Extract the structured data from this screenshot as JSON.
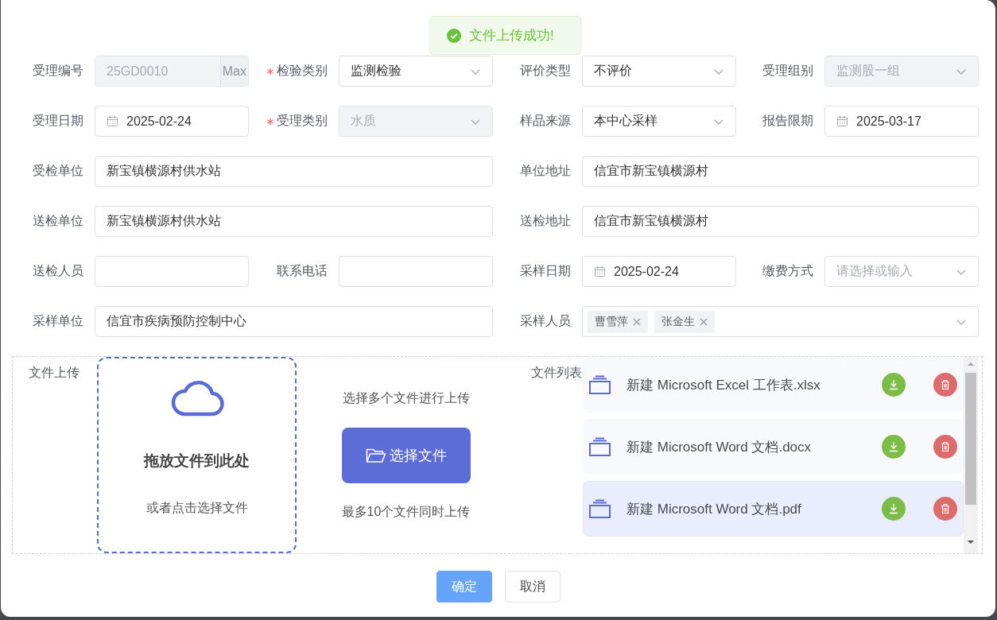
{
  "toast": {
    "message": "文件上传成功!"
  },
  "form_rows": [
    [
      {
        "label": "受理编号",
        "required": false,
        "kind": "addon",
        "value": "25GD0010",
        "addon": "Max",
        "disabled": true,
        "wide": false
      },
      {
        "label": "检验类别",
        "required": true,
        "kind": "select",
        "value": "监测检验",
        "disabled": false,
        "wide": false
      },
      {
        "label": "评价类型",
        "required": false,
        "kind": "select",
        "value": "不评价",
        "disabled": false,
        "wide": false
      },
      {
        "label": "受理组别",
        "required": false,
        "kind": "select",
        "value": "监测股一组",
        "disabled": true,
        "wide": false
      }
    ],
    [
      {
        "label": "受理日期",
        "required": false,
        "kind": "date",
        "value": "2025-02-24",
        "disabled": false,
        "wide": false
      },
      {
        "label": "受理类别",
        "required": true,
        "kind": "select",
        "value": "水质",
        "disabled": true,
        "wide": false
      },
      {
        "label": "样品来源",
        "required": false,
        "kind": "select",
        "value": "本中心采样",
        "disabled": false,
        "wide": false
      },
      {
        "label": "报告限期",
        "required": false,
        "kind": "date",
        "value": "2025-03-17",
        "disabled": false,
        "wide": false
      }
    ],
    [
      {
        "label": "受检单位",
        "required": false,
        "kind": "text",
        "value": "新宝镇横源村供水站",
        "disabled": false,
        "wide": true
      },
      {
        "label": "单位地址",
        "required": false,
        "kind": "text",
        "value": "信宜市新宝镇横源村",
        "disabled": false,
        "wide": true
      }
    ],
    [
      {
        "label": "送检单位",
        "required": false,
        "kind": "text",
        "value": "新宝镇横源村供水站",
        "disabled": false,
        "wide": true
      },
      {
        "label": "送检地址",
        "required": false,
        "kind": "text",
        "value": "信宜市新宝镇横源村",
        "disabled": false,
        "wide": true
      }
    ],
    [
      {
        "label": "送检人员",
        "required": false,
        "kind": "text",
        "disabled": false,
        "wide": false
      },
      {
        "label": "联系电话",
        "required": false,
        "kind": "text",
        "disabled": false,
        "wide": false
      },
      {
        "label": "采样日期",
        "required": false,
        "kind": "date",
        "value": "2025-02-24",
        "disabled": false,
        "wide": false
      },
      {
        "label": "缴费方式",
        "required": false,
        "kind": "select",
        "placeholder": "请选择或输入",
        "disabled": false,
        "wide": false
      }
    ],
    [
      {
        "label": "采样单位",
        "required": false,
        "kind": "text",
        "value": "信宜市疾病预防控制中心",
        "disabled": false,
        "wide": true
      },
      {
        "label": "采样人员",
        "required": false,
        "kind": "tags",
        "tags": [
          "曹雪萍",
          "张金生"
        ],
        "disabled": false,
        "wide": true
      }
    ]
  ],
  "upload": {
    "label": "文件上传",
    "dropzone_title": "拖放文件到此处",
    "dropzone_hint": "或者点击选择文件",
    "top_note": "选择多个文件进行上传",
    "button": "选择文件",
    "bottom_note": "最多10个文件同时上传"
  },
  "file_list": {
    "label": "文件列表",
    "files": [
      {
        "name": "新建 Microsoft Excel 工作表.xlsx",
        "selected": false
      },
      {
        "name": "新建 Microsoft Word 文档.docx",
        "selected": false
      },
      {
        "name": "新建 Microsoft Word 文档.pdf",
        "selected": true
      }
    ]
  },
  "buttons": [
    {
      "label": "确定",
      "kind": "primary"
    },
    {
      "label": "取消",
      "kind": "default"
    }
  ]
}
